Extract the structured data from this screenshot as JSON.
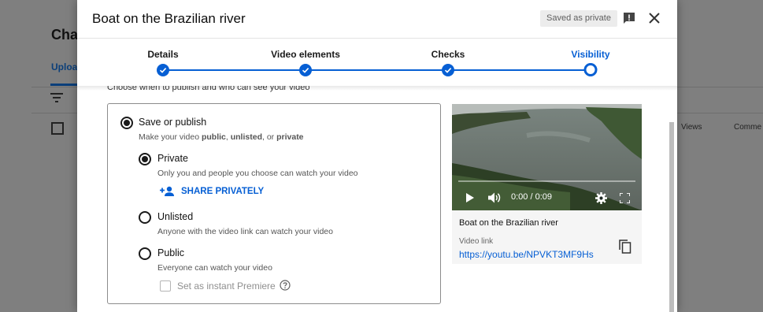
{
  "background": {
    "title": "Cha",
    "tab": "Uploa",
    "columns": {
      "views": "Views",
      "comments": "Comme"
    }
  },
  "dialog": {
    "title": "Boat on the Brazilian river",
    "saved_badge": "Saved as private",
    "icons": {
      "feedback": "feedback-icon",
      "close": "close-icon"
    }
  },
  "steps": [
    {
      "label": "Details",
      "state": "done"
    },
    {
      "label": "Video elements",
      "state": "done"
    },
    {
      "label": "Checks",
      "state": "done"
    },
    {
      "label": "Visibility",
      "state": "current"
    }
  ],
  "section_intro": "Choose when to publish and who can see your video",
  "save_or_publish": {
    "label": "Save or publish",
    "desc_prefix": "Make your video ",
    "desc_public": "public",
    "desc_sep1": ", ",
    "desc_unlisted": "unlisted",
    "desc_sep2": ", or ",
    "desc_private": "private"
  },
  "options": {
    "private": {
      "label": "Private",
      "desc": "Only you and people you choose can watch your video",
      "selected": true
    },
    "share_privately": "SHARE PRIVATELY",
    "unlisted": {
      "label": "Unlisted",
      "desc": "Anyone with the video link can watch your video",
      "selected": false
    },
    "public": {
      "label": "Public",
      "desc": "Everyone can watch your video",
      "selected": false
    },
    "premiere": {
      "label": "Set as instant Premiere",
      "checked": false
    }
  },
  "video": {
    "time": "0:00 / 0:09",
    "title": "Boat on the Brazilian river",
    "link_label": "Video link",
    "link": "https://youtu.be/NPVKT3MF9Hs"
  },
  "colors": {
    "accent": "#065fd4",
    "overlay": "#7f7f7f"
  }
}
